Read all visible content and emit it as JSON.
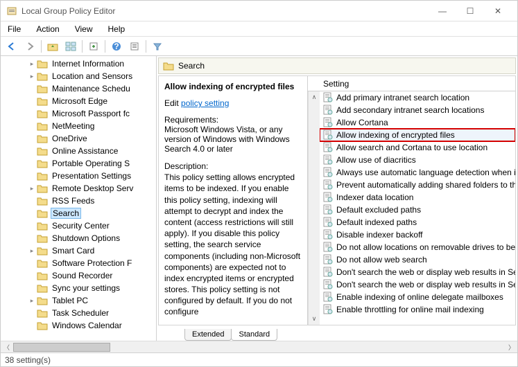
{
  "window": {
    "title": "Local Group Policy Editor",
    "min": "—",
    "max": "☐",
    "close": "✕"
  },
  "menu": {
    "file": "File",
    "action": "Action",
    "view": "View",
    "help": "Help"
  },
  "tree": {
    "items": [
      {
        "label": "Internet Information ",
        "chev": true
      },
      {
        "label": "Location and Sensors",
        "chev": true
      },
      {
        "label": "Maintenance Schedu",
        "chev": false
      },
      {
        "label": "Microsoft Edge",
        "chev": false
      },
      {
        "label": "Microsoft Passport fc",
        "chev": false
      },
      {
        "label": "NetMeeting",
        "chev": false
      },
      {
        "label": "OneDrive",
        "chev": false
      },
      {
        "label": "Online Assistance",
        "chev": false
      },
      {
        "label": "Portable Operating S",
        "chev": false
      },
      {
        "label": "Presentation Settings",
        "chev": false
      },
      {
        "label": "Remote Desktop Serv",
        "chev": true
      },
      {
        "label": "RSS Feeds",
        "chev": false
      },
      {
        "label": "Search",
        "chev": false,
        "selected": true
      },
      {
        "label": "Security Center",
        "chev": false
      },
      {
        "label": "Shutdown Options",
        "chev": false
      },
      {
        "label": "Smart Card",
        "chev": true
      },
      {
        "label": "Software Protection F",
        "chev": false
      },
      {
        "label": "Sound Recorder",
        "chev": false
      },
      {
        "label": "Sync your settings",
        "chev": false
      },
      {
        "label": "Tablet PC",
        "chev": true
      },
      {
        "label": "Task Scheduler",
        "chev": false
      },
      {
        "label": "Windows Calendar",
        "chev": false
      }
    ]
  },
  "header": {
    "title": "Search"
  },
  "detail": {
    "title": "Allow indexing of encrypted files",
    "edit_prefix": "Edit ",
    "edit_link": "policy setting ",
    "req_label": "Requirements:",
    "req_text": "Microsoft Windows Vista, or any version of Windows with Windows Search 4.0 or later",
    "desc_label": "Description:",
    "desc_text": "This policy setting allows encrypted items to be indexed. If you enable this policy setting, indexing  will attempt to decrypt and index the content (access restrictions will still apply). If you disable this policy setting, the search service components (including non-Microsoft components) are expected not to index encrypted items or encrypted stores. This policy setting is not configured by default. If you do not configure"
  },
  "list": {
    "header": "Setting",
    "items": [
      {
        "label": "Add primary intranet search location"
      },
      {
        "label": "Add secondary intranet search locations"
      },
      {
        "label": "Allow Cortana"
      },
      {
        "label": "Allow indexing of encrypted files",
        "highlighted": true
      },
      {
        "label": "Allow search and Cortana to use location"
      },
      {
        "label": "Allow use of diacritics"
      },
      {
        "label": "Always use automatic language detection when in"
      },
      {
        "label": "Prevent automatically adding shared folders to th"
      },
      {
        "label": "Indexer data location"
      },
      {
        "label": "Default excluded paths"
      },
      {
        "label": "Default indexed paths"
      },
      {
        "label": "Disable indexer backoff"
      },
      {
        "label": "Do not allow locations on removable drives to be "
      },
      {
        "label": "Do not allow web search"
      },
      {
        "label": "Don't search the web or display web results in Sea"
      },
      {
        "label": "Don't search the web or display web results in Sea"
      },
      {
        "label": "Enable indexing of online delegate mailboxes"
      },
      {
        "label": "Enable throttling for online mail indexing"
      }
    ]
  },
  "tabs": {
    "extended": "Extended",
    "standard": "Standard"
  },
  "status": {
    "text": "38 setting(s)"
  }
}
